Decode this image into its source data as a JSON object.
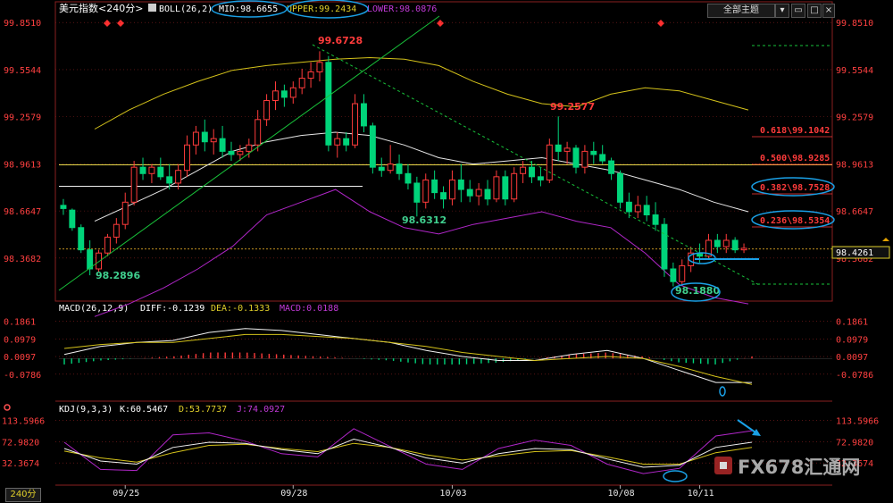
{
  "header": {
    "main_title": "美元指数<240分>",
    "boll_name": "BOLL(26,2)",
    "mid": "MID:98.6655",
    "upper": "UPPER:99.2434",
    "lower": "LOWER:98.0876",
    "theme_button": "全部主题",
    "macd_title": "MACD(26,12,9)",
    "diff": "DIFF:-0.1239",
    "dea": "DEA:-0.1333",
    "macd": "MACD:0.0188",
    "kdj_title": "KDJ(9,3,3)",
    "k": "K:60.5467",
    "d": "D:53.7737",
    "j": "J:74.0927",
    "period_tab": "240分"
  },
  "watermark": "FX678汇通网",
  "colors": {
    "background": "#000000",
    "up": "#ff3b3b",
    "down": "#00d47a",
    "mid": "#e6e6e6",
    "upper": "#d4c21a",
    "lower": "#b026c8",
    "grid": "#8a1f1f",
    "label_red": "#ff3b3b",
    "label_green": "#3fcf8e",
    "axis_text": "#ff4040",
    "highlight": "#1aa0e6"
  },
  "chart_data": [
    {
      "type": "candlestick",
      "panel": "price",
      "y_axis_labels": [
        "99.8510",
        "99.5544",
        "99.2579",
        "98.9613",
        "98.6647",
        "98.3682"
      ],
      "ylim": [
        98.12,
        99.88
      ],
      "x_tick_labels": [
        "09/25",
        "09/28",
        "10/03",
        "10/08",
        "10/11"
      ],
      "last_price": "98.4261",
      "annotations": [
        "99.6728",
        "99.2577",
        "98.6312",
        "98.2896",
        "98.1880"
      ],
      "fib_levels": [
        "0.618\\99.1042",
        "0.500\\98.9285",
        "0.382\\98.7528",
        "0.236\\98.5354"
      ],
      "ohlc": [
        [
          98.7,
          98.74,
          98.64,
          98.68
        ],
        [
          98.67,
          98.68,
          98.54,
          98.56
        ],
        [
          98.56,
          98.58,
          98.4,
          98.42
        ],
        [
          98.42,
          98.48,
          98.26,
          98.3
        ],
        [
          98.3,
          98.42,
          98.28,
          98.4
        ],
        [
          98.4,
          98.52,
          98.38,
          98.5
        ],
        [
          98.5,
          98.62,
          98.46,
          98.58
        ],
        [
          98.58,
          98.78,
          98.55,
          98.72
        ],
        [
          98.72,
          98.98,
          98.7,
          98.94
        ],
        [
          98.94,
          99.0,
          98.86,
          98.9
        ],
        [
          98.9,
          98.96,
          98.84,
          98.94
        ],
        [
          98.94,
          99.0,
          98.86,
          98.88
        ],
        [
          98.88,
          98.96,
          98.8,
          98.84
        ],
        [
          98.84,
          98.96,
          98.8,
          98.92
        ],
        [
          98.92,
          99.14,
          98.88,
          99.08
        ],
        [
          99.08,
          99.2,
          99.02,
          99.16
        ],
        [
          99.16,
          99.24,
          99.04,
          99.1
        ],
        [
          99.1,
          99.18,
          99.02,
          99.12
        ],
        [
          99.12,
          99.2,
          99.0,
          99.04
        ],
        [
          99.04,
          99.1,
          98.98,
          99.02
        ],
        [
          99.02,
          99.08,
          98.98,
          99.04
        ],
        [
          99.04,
          99.12,
          99.0,
          99.08
        ],
        [
          99.08,
          99.3,
          99.04,
          99.24
        ],
        [
          99.24,
          99.4,
          99.2,
          99.36
        ],
        [
          99.36,
          99.48,
          99.3,
          99.42
        ],
        [
          99.42,
          99.46,
          99.32,
          99.38
        ],
        [
          99.38,
          99.48,
          99.34,
          99.44
        ],
        [
          99.44,
          99.56,
          99.4,
          99.5
        ],
        [
          99.5,
          99.6,
          99.44,
          99.54
        ],
        [
          99.54,
          99.67,
          99.48,
          99.6
        ],
        [
          99.6,
          99.64,
          99.04,
          99.08
        ],
        [
          99.08,
          99.16,
          99.0,
          99.12
        ],
        [
          99.12,
          99.16,
          99.04,
          99.08
        ],
        [
          99.08,
          99.4,
          99.06,
          99.34
        ],
        [
          99.34,
          99.4,
          99.16,
          99.2
        ],
        [
          99.2,
          99.22,
          98.9,
          98.94
        ],
        [
          98.94,
          99.0,
          98.88,
          98.92
        ],
        [
          98.92,
          99.08,
          98.9,
          98.96
        ],
        [
          98.96,
          99.02,
          98.86,
          98.9
        ],
        [
          98.9,
          98.96,
          98.8,
          98.84
        ],
        [
          98.84,
          98.88,
          98.63,
          98.72
        ],
        [
          98.72,
          98.9,
          98.68,
          98.86
        ],
        [
          98.86,
          98.92,
          98.74,
          98.78
        ],
        [
          98.78,
          98.82,
          98.68,
          98.74
        ],
        [
          98.74,
          98.92,
          98.7,
          98.86
        ],
        [
          98.86,
          98.96,
          98.72,
          98.8
        ],
        [
          98.8,
          98.86,
          98.72,
          98.76
        ],
        [
          98.76,
          98.84,
          98.7,
          98.8
        ],
        [
          98.8,
          98.86,
          98.7,
          98.74
        ],
        [
          98.74,
          98.92,
          98.72,
          98.88
        ],
        [
          98.88,
          98.92,
          98.7,
          98.74
        ],
        [
          98.74,
          98.94,
          98.72,
          98.9
        ],
        [
          98.9,
          98.98,
          98.84,
          98.94
        ],
        [
          98.94,
          98.98,
          98.84,
          98.88
        ],
        [
          98.88,
          98.94,
          98.82,
          98.86
        ],
        [
          98.86,
          99.12,
          98.84,
          99.08
        ],
        [
          99.08,
          99.26,
          98.98,
          99.04
        ],
        [
          99.04,
          99.1,
          98.96,
          99.06
        ],
        [
          99.06,
          99.08,
          98.9,
          98.94
        ],
        [
          98.94,
          99.08,
          98.9,
          99.04
        ],
        [
          99.04,
          99.1,
          98.96,
          99.02
        ],
        [
          99.02,
          99.08,
          98.96,
          98.98
        ],
        [
          98.98,
          99.0,
          98.86,
          98.9
        ],
        [
          98.9,
          98.92,
          98.68,
          98.72
        ],
        [
          98.72,
          98.78,
          98.62,
          98.66
        ],
        [
          98.66,
          98.76,
          98.62,
          98.7
        ],
        [
          98.7,
          98.76,
          98.6,
          98.64
        ],
        [
          98.64,
          98.72,
          98.54,
          98.58
        ],
        [
          98.58,
          98.62,
          98.25,
          98.3
        ],
        [
          98.3,
          98.34,
          98.19,
          98.22
        ],
        [
          98.22,
          98.36,
          98.2,
          98.32
        ],
        [
          98.32,
          98.44,
          98.28,
          98.4
        ],
        [
          98.4,
          98.46,
          98.34,
          98.38
        ],
        [
          98.38,
          98.52,
          98.36,
          98.48
        ],
        [
          98.48,
          98.52,
          98.4,
          98.44
        ],
        [
          98.44,
          98.52,
          98.4,
          98.48
        ],
        [
          98.48,
          98.5,
          98.4,
          98.42
        ],
        [
          98.42,
          98.46,
          98.4,
          98.43
        ]
      ],
      "upper": [
        99.18,
        99.3,
        99.4,
        99.48,
        99.55,
        99.58,
        99.6,
        99.62,
        99.63,
        99.62,
        99.58,
        99.48,
        99.4,
        99.34,
        99.32,
        99.4,
        99.44,
        99.42,
        99.36,
        99.3
      ],
      "mid": [
        98.6,
        98.7,
        98.8,
        98.92,
        99.04,
        99.1,
        99.14,
        99.16,
        99.14,
        99.08,
        99.0,
        98.96,
        98.98,
        99.0,
        98.96,
        98.92,
        98.86,
        98.8,
        98.72,
        98.66
      ],
      "lower": [
        98.0,
        98.08,
        98.18,
        98.3,
        98.44,
        98.64,
        98.72,
        98.8,
        98.66,
        98.56,
        98.52,
        98.58,
        98.62,
        98.66,
        98.6,
        98.56,
        98.4,
        98.2,
        98.12,
        98.08
      ],
      "horizontal_lines": [
        {
          "price": 98.955,
          "color": "yellow"
        },
        {
          "price": 98.82,
          "color": "white"
        }
      ],
      "dashed_levels": [
        99.6,
        98.17
      ]
    },
    {
      "type": "macd",
      "panel": "macd",
      "y_axis_labels": [
        "0.1861",
        "0.0979",
        "0.0097",
        "-0.0786"
      ],
      "ylim": [
        -0.2,
        0.22
      ],
      "diff": [
        0.02,
        0.06,
        0.08,
        0.09,
        0.13,
        0.15,
        0.14,
        0.12,
        0.1,
        0.08,
        0.04,
        0.01,
        -0.01,
        -0.01,
        0.02,
        0.04,
        0.0,
        -0.06,
        -0.12,
        -0.12
      ],
      "dea": [
        0.05,
        0.07,
        0.08,
        0.08,
        0.1,
        0.12,
        0.12,
        0.11,
        0.1,
        0.08,
        0.06,
        0.03,
        0.01,
        -0.01,
        0.0,
        0.01,
        0.0,
        -0.04,
        -0.09,
        -0.13
      ],
      "macd": [
        -0.03,
        -0.01,
        0.0,
        0.01,
        0.03,
        0.03,
        0.02,
        0.01,
        0.0,
        -0.01,
        -0.03,
        -0.03,
        -0.02,
        0.0,
        0.02,
        0.03,
        0.01,
        -0.02,
        -0.03,
        0.01
      ]
    },
    {
      "type": "kdj",
      "panel": "kdj",
      "y_axis_labels": [
        "113.5966",
        "72.9820",
        "32.3674"
      ],
      "ylim": [
        -5,
        125
      ],
      "k": [
        60,
        36,
        30,
        62,
        72,
        70,
        58,
        50,
        78,
        62,
        42,
        32,
        50,
        60,
        58,
        40,
        24,
        28,
        62,
        72
      ],
      "d": [
        55,
        42,
        34,
        52,
        66,
        68,
        60,
        54,
        70,
        62,
        48,
        38,
        46,
        54,
        56,
        44,
        30,
        30,
        52,
        62
      ],
      "j": [
        72,
        20,
        18,
        86,
        90,
        74,
        50,
        44,
        98,
        64,
        30,
        20,
        60,
        76,
        66,
        30,
        12,
        22,
        84,
        94
      ]
    }
  ]
}
